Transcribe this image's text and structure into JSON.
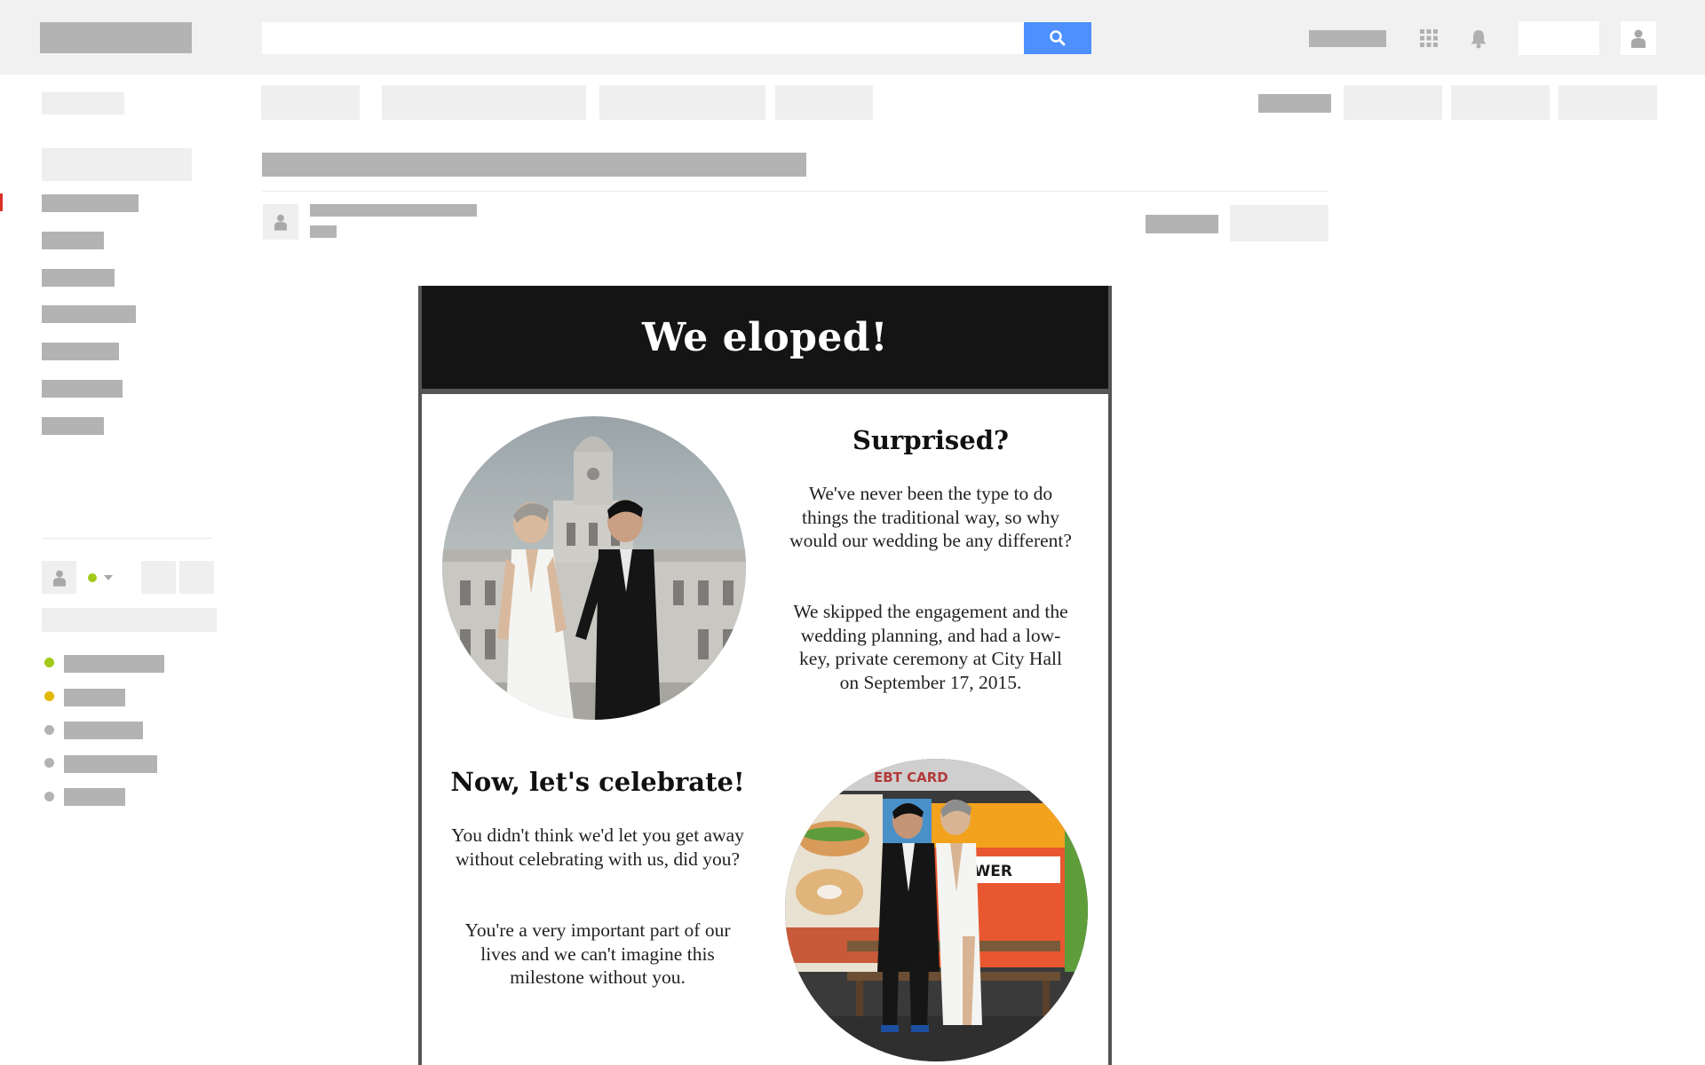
{
  "search": {
    "placeholder": "",
    "value": ""
  },
  "icons": {
    "search": "search-icon",
    "apps": "apps-grid-icon",
    "notifications": "bell-icon",
    "account": "account-icon",
    "sender": "person-icon",
    "presence": "presence-dot-icon",
    "dropdown": "chevron-down-icon"
  },
  "colors": {
    "accent": "#4d90fe",
    "header_bg": "#141414",
    "presence_online": "#a3c91a",
    "presence_idle": "#e3b800",
    "presence_offline": "#b3b3b3",
    "active_marker": "#d93025"
  },
  "email": {
    "headline": "We eloped!",
    "section1": {
      "title": "Surprised?",
      "paragraph1": "We've never been the type to do things the traditional way, so why would our wedding be any different?",
      "paragraph2": "We skipped the engagement and the wedding planning, and had a low-key, private ceremony at City Hall on September 17, 2015."
    },
    "section2": {
      "title": "Now, let's celebrate!",
      "paragraph1": "You didn't think we'd let you get away without celebrating with us, did you?",
      "paragraph2": "You're a very important part of our lives and we can't imagine this milestone without you."
    },
    "photo2_signage": {
      "ebt": "EBT CARD",
      "lottery": "OWER"
    }
  }
}
